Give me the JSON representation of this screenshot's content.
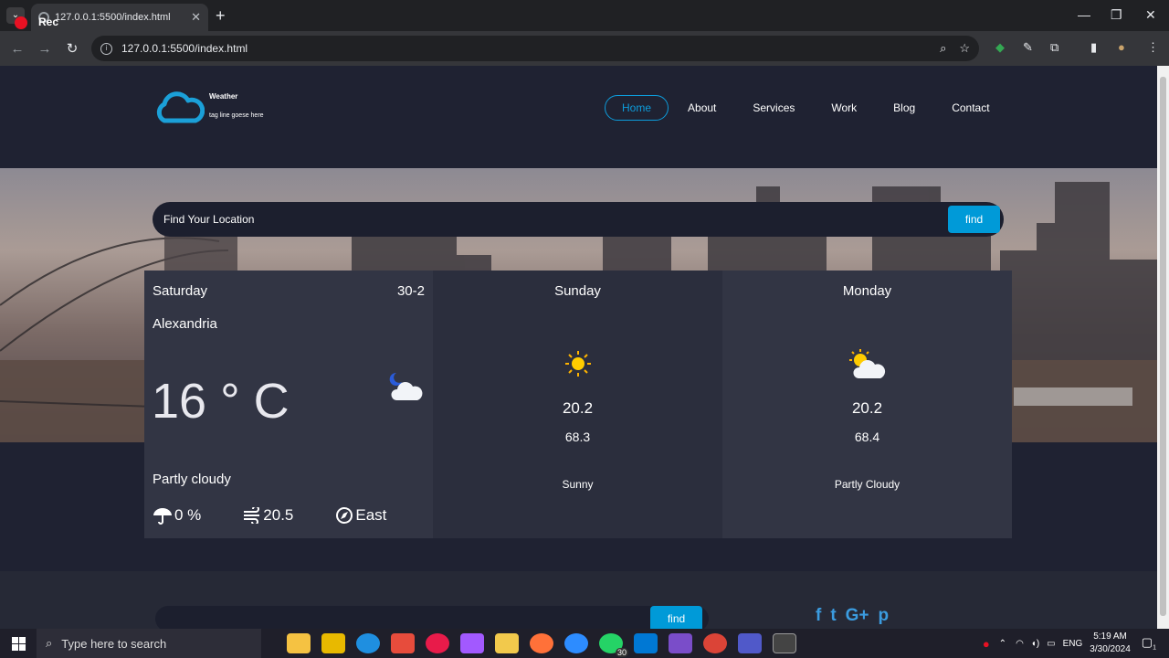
{
  "browser": {
    "recording_label": "Rec",
    "tab_title": "127.0.0.1:5500/index.html",
    "url": "127.0.0.1:5500/index.html"
  },
  "site": {
    "brand": "Weather",
    "tagline": "tag line goese here",
    "nav": [
      "Home",
      "About",
      "Services",
      "Work",
      "Blog",
      "Contact"
    ],
    "nav_active": "Home"
  },
  "search": {
    "placeholder": "Find Your Location",
    "button": "find"
  },
  "today": {
    "day": "Saturday",
    "date": "30-2",
    "city": "Alexandria",
    "temp": "16 ° C",
    "condition": "Partly cloudy",
    "rain": "0 %",
    "wind": "20.5",
    "direction": "East",
    "icon": "moon-cloud-icon"
  },
  "forecast": [
    {
      "day": "Sunday",
      "max": "20.2",
      "min": "68.3",
      "desc": "Sunny",
      "icon": "sun-icon"
    },
    {
      "day": "Monday",
      "max": "20.2",
      "min": "68.4",
      "desc": "Partly Cloudy",
      "icon": "sun-cloud-icon"
    }
  ],
  "footer": {
    "button": "find",
    "social": [
      "f",
      "t",
      "G+",
      "p"
    ]
  },
  "taskbar": {
    "search_placeholder": "Type here to search",
    "whatsapp_badge": "30",
    "lang": "ENG",
    "time": "5:19 AM",
    "date": "3/30/2024",
    "notif_count": "1"
  },
  "colors": {
    "accent": "#009ad8",
    "page_bg": "#1f2232",
    "card_a": "#323544",
    "card_b": "#2b2e3d"
  }
}
